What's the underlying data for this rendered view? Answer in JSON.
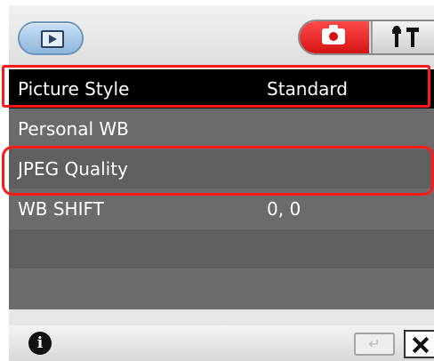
{
  "menu": {
    "items": [
      {
        "label": "Picture Style",
        "value": "Standard"
      },
      {
        "label": "Personal WB",
        "value": ""
      },
      {
        "label": "JPEG Quality",
        "value": ""
      },
      {
        "label": "WB SHIFT",
        "value": "0, 0"
      },
      {
        "label": "",
        "value": ""
      },
      {
        "label": "",
        "value": ""
      }
    ]
  },
  "bottom": {
    "info_glyph": "i",
    "return_glyph": "↵"
  },
  "colors": {
    "highlight": "#ff1a1a",
    "camera_tab": "#e11e1e"
  }
}
